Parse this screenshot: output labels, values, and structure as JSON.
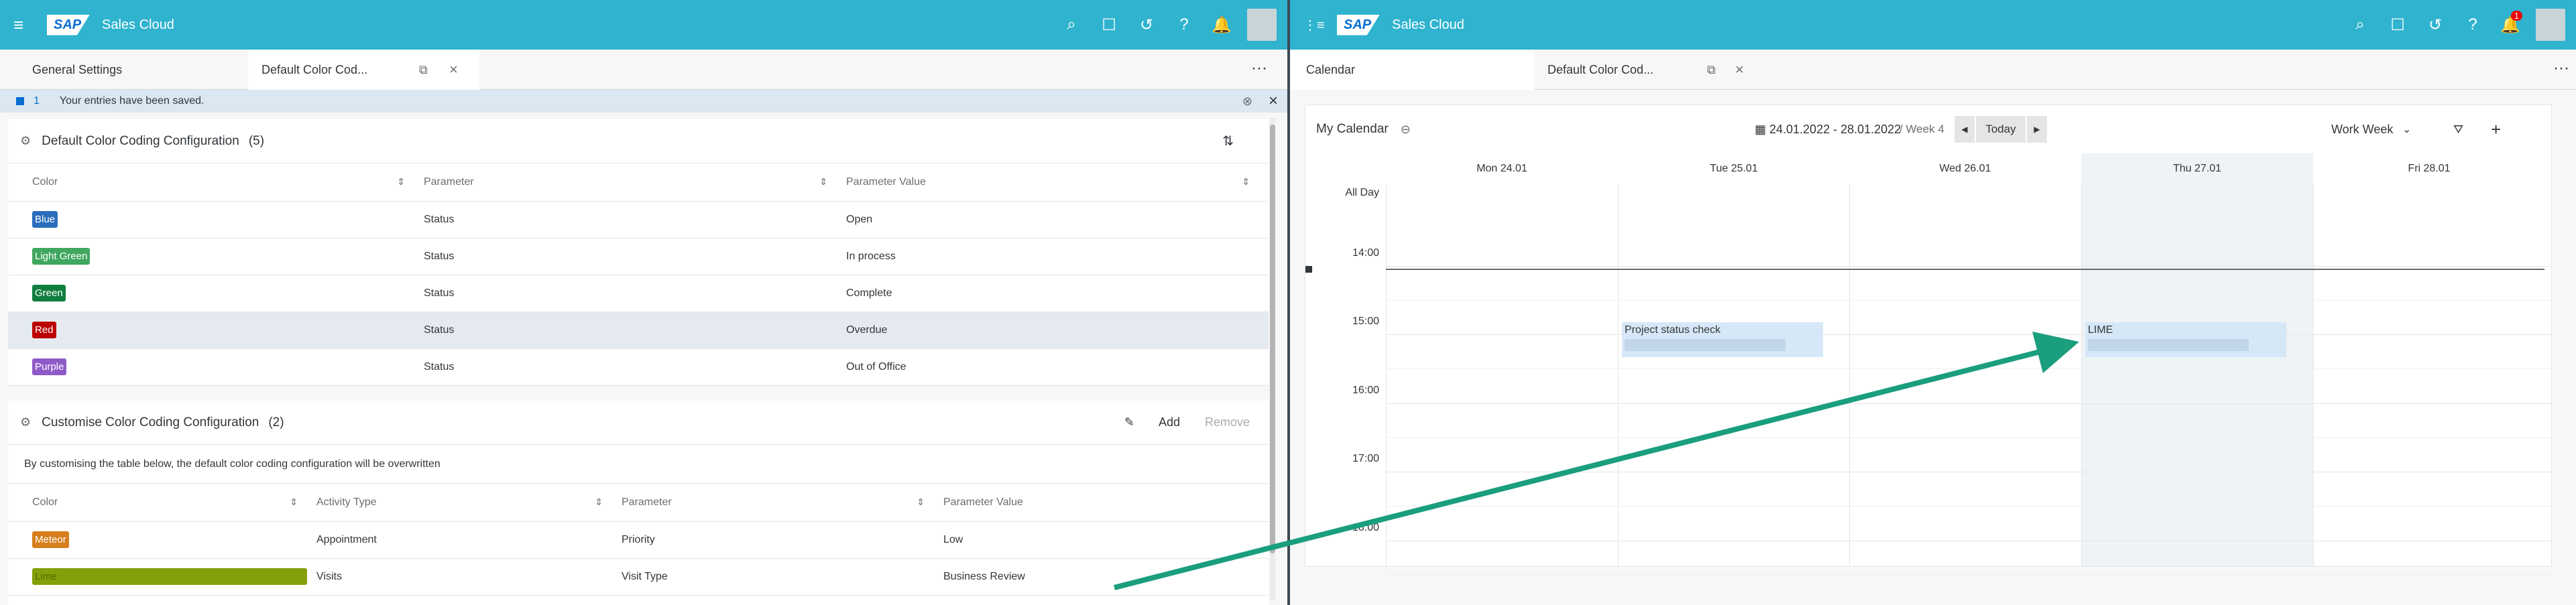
{
  "left": {
    "shell": {
      "brand": "SAP",
      "title": "Sales Cloud",
      "icons": [
        "search-icon",
        "chat-icon",
        "history-icon",
        "help-icon",
        "bell-icon"
      ]
    },
    "tabs": [
      {
        "label": "General Settings"
      },
      {
        "label": "Default Color Cod..."
      }
    ],
    "message": {
      "count": "1",
      "text": "Your entries have been saved."
    },
    "default_config": {
      "title": "Default Color Coding Configuration",
      "count": "(5)",
      "columns": [
        "Color",
        "Parameter",
        "Parameter Value"
      ],
      "rows": [
        {
          "color": "Blue",
          "hex": "#2a6ebb",
          "parameter": "Status",
          "value": "Open"
        },
        {
          "color": "Light Green",
          "hex": "#3fa75f",
          "parameter": "Status",
          "value": "In process"
        },
        {
          "color": "Green",
          "hex": "#107e3e",
          "parameter": "Status",
          "value": "Complete"
        },
        {
          "color": "Red",
          "hex": "#bb0000",
          "parameter": "Status",
          "value": "Overdue"
        },
        {
          "color": "Purple",
          "hex": "#8e5ac8",
          "parameter": "Status",
          "value": "Out of Office"
        }
      ]
    },
    "custom_config": {
      "title": "Customise Color Coding Configuration",
      "count": "(2)",
      "add": "Add",
      "remove": "Remove",
      "info": "By customising the table below, the default color coding configuration will be overwritten",
      "columns": [
        "Color",
        "Activity Type",
        "Parameter",
        "Parameter Value"
      ],
      "rows": [
        {
          "color": "Meteor",
          "hex": "#d67e1c",
          "activity": "Appointment",
          "parameter": "Priority",
          "value": "Low"
        },
        {
          "color": "Lime",
          "hex": "#84a00a",
          "activity": "Visits",
          "parameter": "Visit Type",
          "value": "Business Review"
        }
      ]
    }
  },
  "right": {
    "shell": {
      "brand": "SAP",
      "title": "Sales Cloud",
      "notification_count": "1"
    },
    "tabs": [
      {
        "label": "Calendar"
      },
      {
        "label": "Default Color Cod..."
      }
    ],
    "calendar": {
      "title": "My Calendar",
      "range": "24.01.2022 - 28.01.2022",
      "week": "/ Week 4",
      "today": "Today",
      "view": "Work Week",
      "days": [
        "Mon 24.01",
        "Tue 25.01",
        "Wed 26.01",
        "Thu 27.01",
        "Fri 28.01"
      ],
      "allday": "All Day",
      "hours": [
        "14:00",
        "15:00",
        "16:00",
        "17:00",
        "18:00"
      ],
      "appointments": [
        {
          "title": "Project status check",
          "day": "Tue 25.01"
        },
        {
          "title": "LIME",
          "day": "Thu 27.01"
        }
      ]
    }
  },
  "colors": {
    "shell": "#2fb3cf",
    "arrow": "#1a9e7e",
    "strip": "#dbe7f1"
  }
}
